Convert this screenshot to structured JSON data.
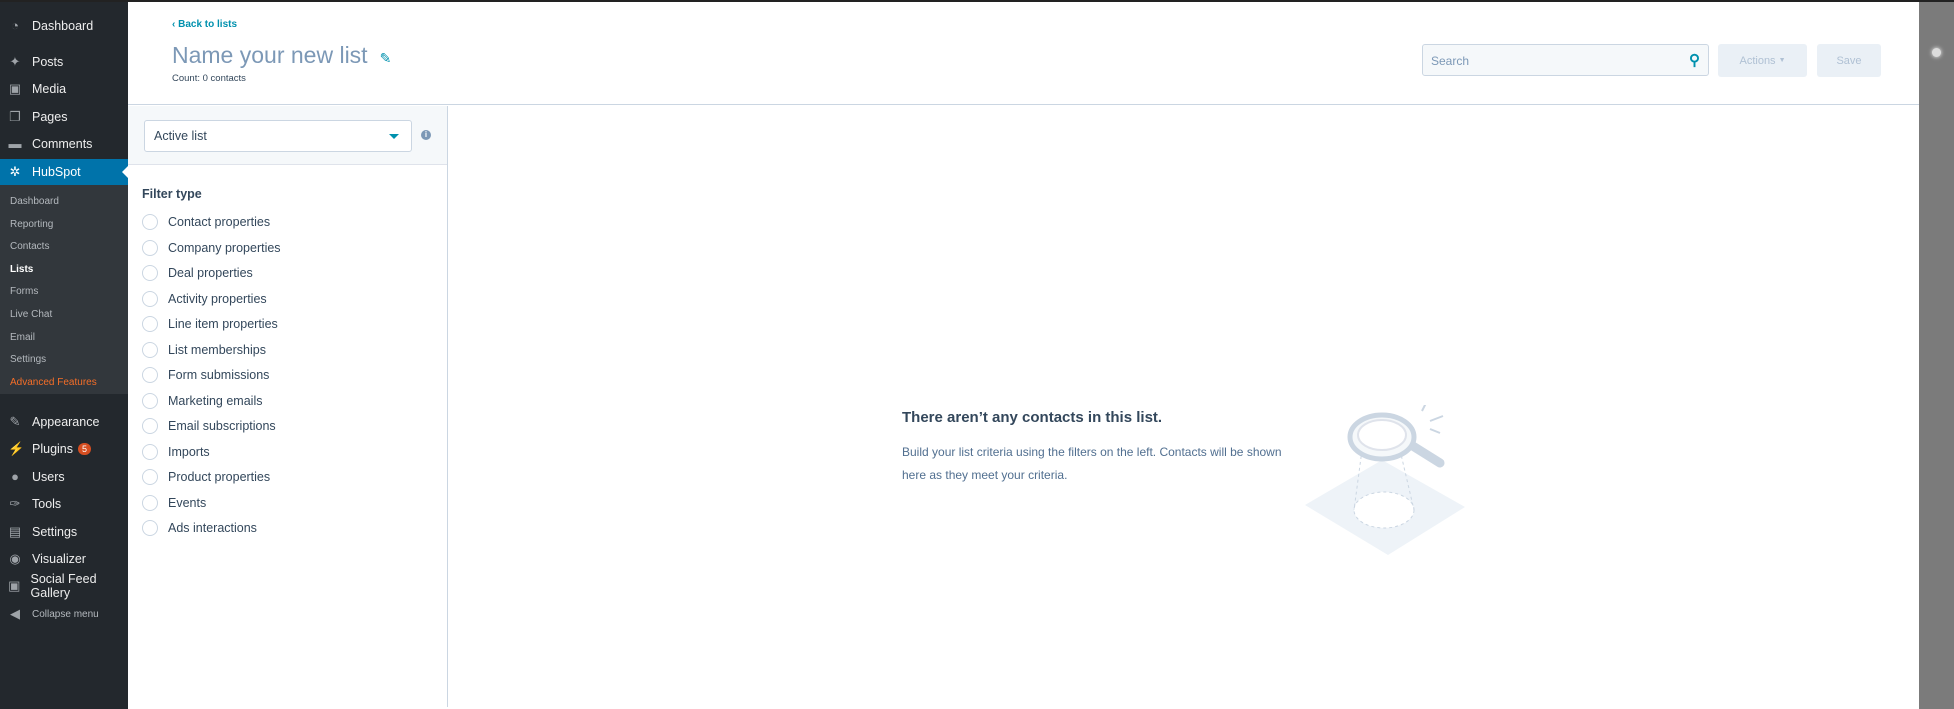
{
  "sidebar": {
    "top": [
      {
        "label": "Dashboard",
        "icon": "dashboard-icon"
      },
      {
        "label": "Posts",
        "icon": "pin-icon"
      },
      {
        "label": "Media",
        "icon": "media-icon"
      },
      {
        "label": "Pages",
        "icon": "pages-icon"
      },
      {
        "label": "Comments",
        "icon": "comment-icon"
      },
      {
        "label": "HubSpot",
        "icon": "hubspot-icon"
      }
    ],
    "sub": [
      "Dashboard",
      "Reporting",
      "Contacts",
      "Lists",
      "Forms",
      "Live Chat",
      "Email",
      "Settings",
      "Advanced Features"
    ],
    "bottom": [
      {
        "label": "Appearance",
        "icon": "brush-icon"
      },
      {
        "label": "Plugins",
        "icon": "plug-icon",
        "badge": "5"
      },
      {
        "label": "Users",
        "icon": "user-icon"
      },
      {
        "label": "Tools",
        "icon": "wrench-icon"
      },
      {
        "label": "Settings",
        "icon": "settings-icon"
      },
      {
        "label": "Visualizer",
        "icon": "chart-icon"
      },
      {
        "label": "Social Feed Gallery",
        "icon": "camera-icon"
      },
      {
        "label": "Collapse menu",
        "icon": "collapse-icon"
      }
    ]
  },
  "header": {
    "back": "Back to lists",
    "title": "Name your new list",
    "count": "Count: 0 contacts",
    "search_placeholder": "Search",
    "actions": "Actions",
    "save": "Save"
  },
  "filters": {
    "list_type": "Active list",
    "heading": "Filter type",
    "options": [
      "Contact properties",
      "Company properties",
      "Deal properties",
      "Activity properties",
      "Line item properties",
      "List memberships",
      "Form submissions",
      "Marketing emails",
      "Email subscriptions",
      "Imports",
      "Product properties",
      "Events",
      "Ads interactions"
    ]
  },
  "empty": {
    "heading": "There aren’t any contacts in this list.",
    "body": "Build your list criteria using the filters on the left. Contacts will be shown here as they meet your criteria."
  },
  "colors": {
    "accent": "#0091ae",
    "sidebar": "#23282d",
    "wp_blue": "#0073aa",
    "advanced": "#f56e28"
  }
}
